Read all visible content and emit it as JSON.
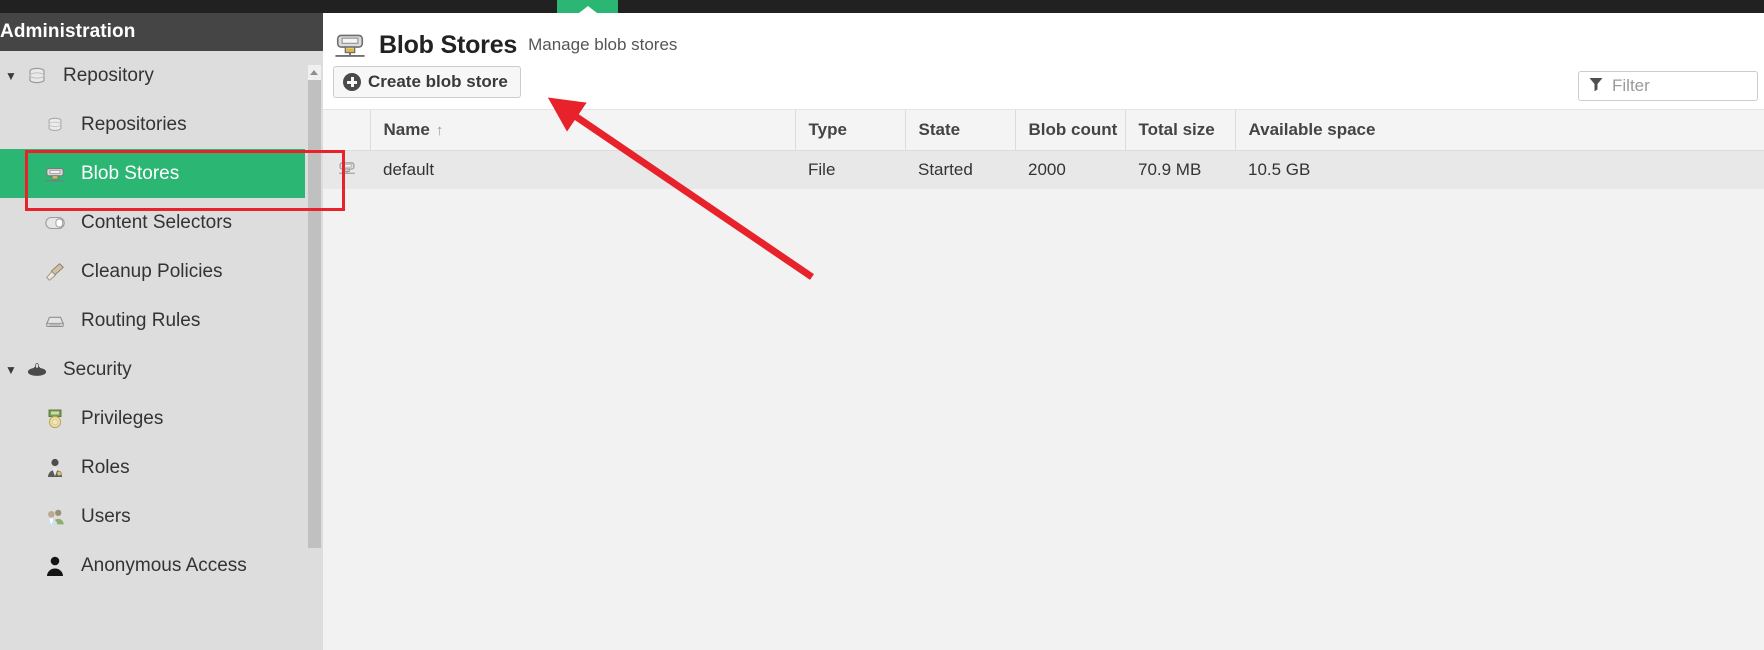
{
  "browser": {
    "tab_icon": "caret-up-icon",
    "tab_accent": "#2bb673"
  },
  "sidebar": {
    "header": "Administration",
    "selected_item": "Blob Stores",
    "selected_color": "#2bb673",
    "items": [
      {
        "label": "Repository",
        "icon": "database-icon",
        "level": "group",
        "expanded": true
      },
      {
        "label": "Repositories",
        "icon": "database-icon",
        "level": "child"
      },
      {
        "label": "Blob Stores",
        "icon": "blob-store-icon",
        "level": "child",
        "selected": true
      },
      {
        "label": "Content Selectors",
        "icon": "content-selector-icon",
        "level": "child"
      },
      {
        "label": "Cleanup Policies",
        "icon": "broom-icon",
        "level": "child"
      },
      {
        "label": "Routing Rules",
        "icon": "routing-icon",
        "level": "child"
      },
      {
        "label": "Security",
        "icon": "security-icon",
        "level": "group",
        "expanded": true
      },
      {
        "label": "Privileges",
        "icon": "medal-icon",
        "level": "child"
      },
      {
        "label": "Roles",
        "icon": "role-person-icon",
        "level": "child"
      },
      {
        "label": "Users",
        "icon": "users-icon",
        "level": "child"
      },
      {
        "label": "Anonymous Access",
        "icon": "person-icon",
        "level": "child"
      }
    ]
  },
  "page": {
    "icon": "blob-store-icon",
    "title": "Blob Stores",
    "subtitle": "Manage blob stores"
  },
  "toolbar": {
    "create_label": "Create blob store",
    "create_icon": "plus-circle-icon"
  },
  "filter": {
    "icon": "funnel-icon",
    "placeholder": "Filter",
    "value": ""
  },
  "table": {
    "columns": [
      "Name",
      "Type",
      "State",
      "Blob count",
      "Total size",
      "Available space"
    ],
    "sort_column": "Name",
    "sort_direction": "ascending",
    "sort_indicator": "↑",
    "rows": [
      {
        "icon": "blob-store-icon",
        "name": "default",
        "type": "File",
        "state": "Started",
        "blob_count": "2000",
        "total_size": "70.9 MB",
        "available_space": "10.5 GB"
      }
    ]
  },
  "annotations": {
    "highlight_color": "#e8222a",
    "rect_target": "Blob Stores",
    "arrow_target": "Create blob store"
  }
}
